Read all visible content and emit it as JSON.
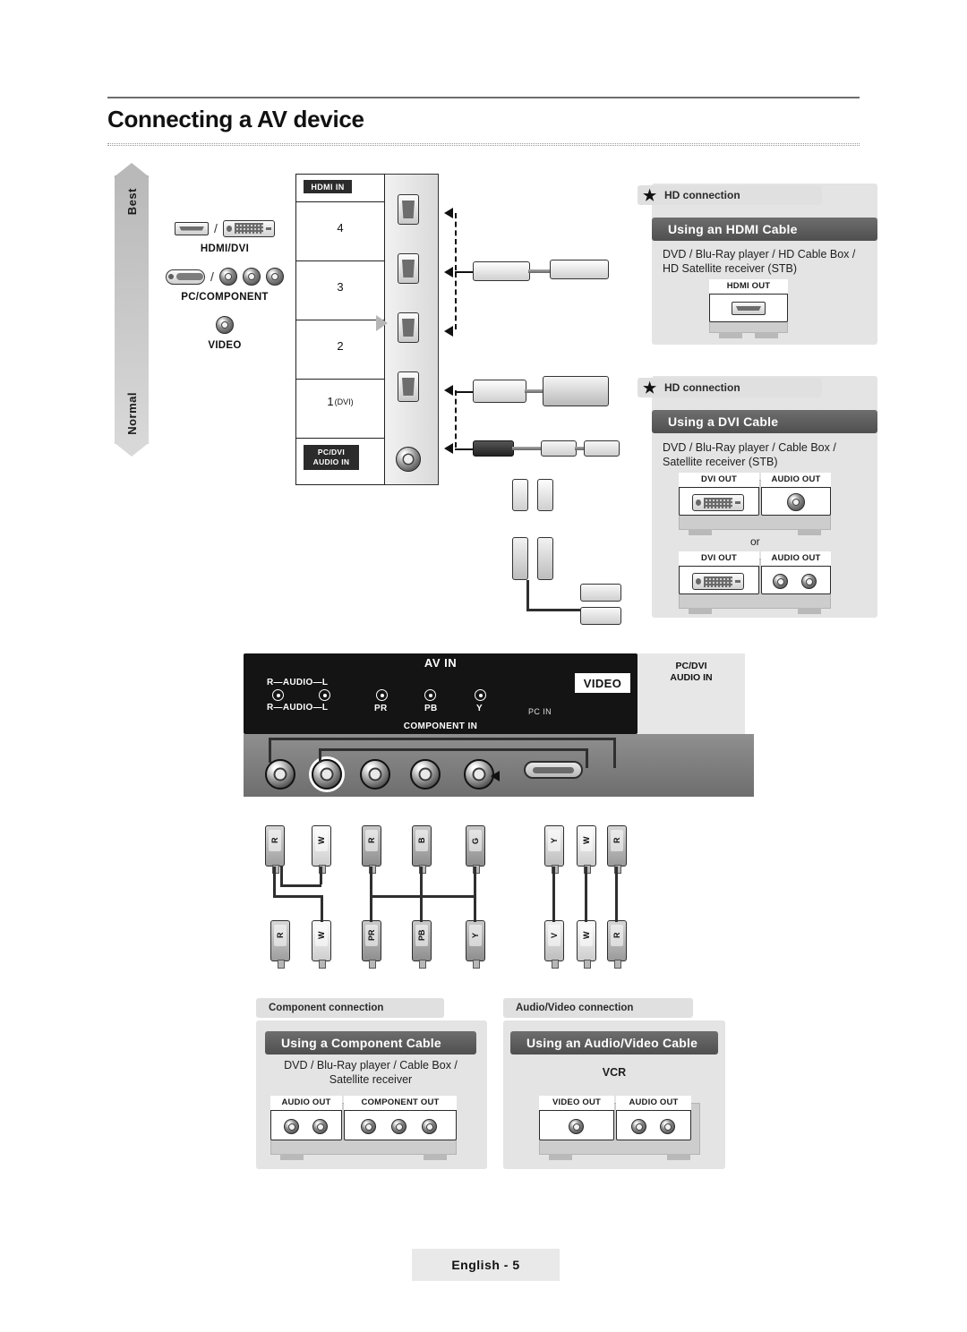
{
  "page": {
    "title": "Connecting a AV device",
    "footer_label": "English - 5"
  },
  "quality_bar": {
    "top_label": "Best",
    "bottom_label": "Normal"
  },
  "legend": {
    "rows": [
      {
        "caption": "HDMI/DVI",
        "separator": "/"
      },
      {
        "caption": "PC/COMPONENT",
        "separator": "/"
      },
      {
        "caption": "VIDEO",
        "separator": ""
      }
    ]
  },
  "tv_panel": {
    "hdmi_in_label": "HDMI IN",
    "port_numbers": [
      "4",
      "3",
      "2",
      "1"
    ],
    "port_1_suffix": "(DVI)",
    "audio_in_label_line1": "PC/DVI",
    "audio_in_label_line2": "AUDIO IN"
  },
  "hdmi_section": {
    "badge": "HD connection",
    "heading": "Using an HDMI Cable",
    "description": "DVD / Blu-Ray player / HD Cable Box / HD Satellite receiver (STB)",
    "port_label": "HDMI OUT"
  },
  "dvi_section": {
    "badge": "HD connection",
    "heading": "Using a DVI Cable",
    "description": "DVD / Blu-Ray player / Cable Box / Satellite receiver (STB)",
    "or_text": "or",
    "device_top": {
      "dvi_label": "DVI OUT",
      "audio_label": "AUDIO OUT"
    },
    "device_bottom": {
      "dvi_label": "DVI OUT",
      "audio_label": "AUDIO OUT"
    }
  },
  "av_in_panel": {
    "title": "AV IN",
    "row1_label_left": "R",
    "row1_label_mid": "AUDIO",
    "row1_label_right": "L",
    "row2_label_left": "R",
    "row2_label_mid": "AUDIO",
    "row2_label_right": "L",
    "video_label": "VIDEO",
    "component_label": "COMPONENT IN",
    "component_channels": [
      "PR",
      "PB",
      "Y"
    ],
    "pc_in_label": "PC IN",
    "pc_dvi_audio_line1": "PC/DVI",
    "pc_dvi_audio_line2": "AUDIO IN"
  },
  "cable_plugs": {
    "component_top": [
      "R",
      "W",
      "R",
      "B",
      "G"
    ],
    "component_bottom": [
      "R",
      "W",
      "PR",
      "PB",
      "Y"
    ],
    "av_top": [
      "Y",
      "W",
      "R"
    ],
    "av_bottom": [
      "V",
      "W",
      "R"
    ]
  },
  "component_section": {
    "badge": "Component connection",
    "heading": "Using a Component Cable",
    "description": "DVD / Blu-Ray player / Cable Box / Satellite receiver",
    "audio_out_label": "AUDIO OUT",
    "component_out_label": "COMPONENT OUT"
  },
  "av_section": {
    "badge": "Audio/Video connection",
    "heading": "Using an Audio/Video Cable",
    "description": "VCR",
    "video_out_label": "VIDEO OUT",
    "audio_out_label": "AUDIO OUT"
  },
  "icons": {
    "star": "★",
    "hdmi_port": "hdmi-port-icon",
    "dvi_port": "dvi-port-icon",
    "vga_port": "vga-port-icon",
    "rca_jack": "rca-jack-icon"
  }
}
